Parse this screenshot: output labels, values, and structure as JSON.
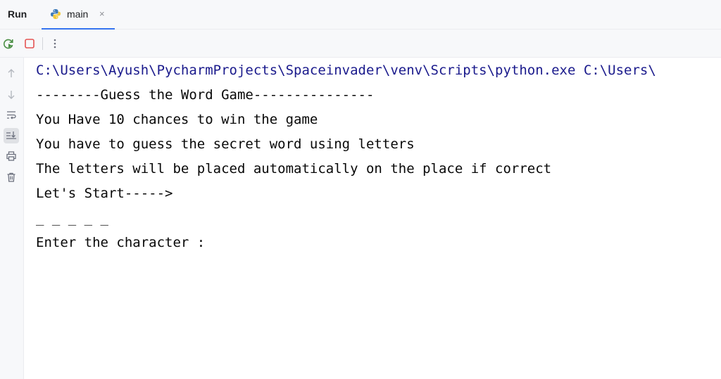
{
  "header": {
    "run_label": "Run"
  },
  "tab": {
    "label": "main",
    "close_glyph": "×",
    "icon": "python-icon"
  },
  "toolbar": {
    "buttons": [
      "rerun-icon",
      "stop-icon",
      "more-vertical-icon"
    ]
  },
  "sidebar": {
    "buttons": [
      "arrow-up-icon",
      "arrow-down-icon",
      "soft-wrap-icon",
      "scroll-to-end-icon",
      "print-icon",
      "trash-icon"
    ],
    "active": "scroll-to-end-icon"
  },
  "console": {
    "lines": [
      "C:\\Users\\Ayush\\PycharmProjects\\Spaceinvader\\venv\\Scripts\\python.exe C:\\Users\\",
      "--------Guess the Word Game---------------",
      "You Have 10 chances to win the game",
      "You have to guess the secret word using letters",
      "The letters will be placed automatically on the place if correct",
      "Let's Start----->",
      "_ _ _ _ _",
      "Enter the character :"
    ]
  },
  "colors": {
    "accent": "#3574f0",
    "command_text": "#1a1a8c",
    "output_text": "#080808",
    "panel_bg": "#f7f8fa"
  }
}
